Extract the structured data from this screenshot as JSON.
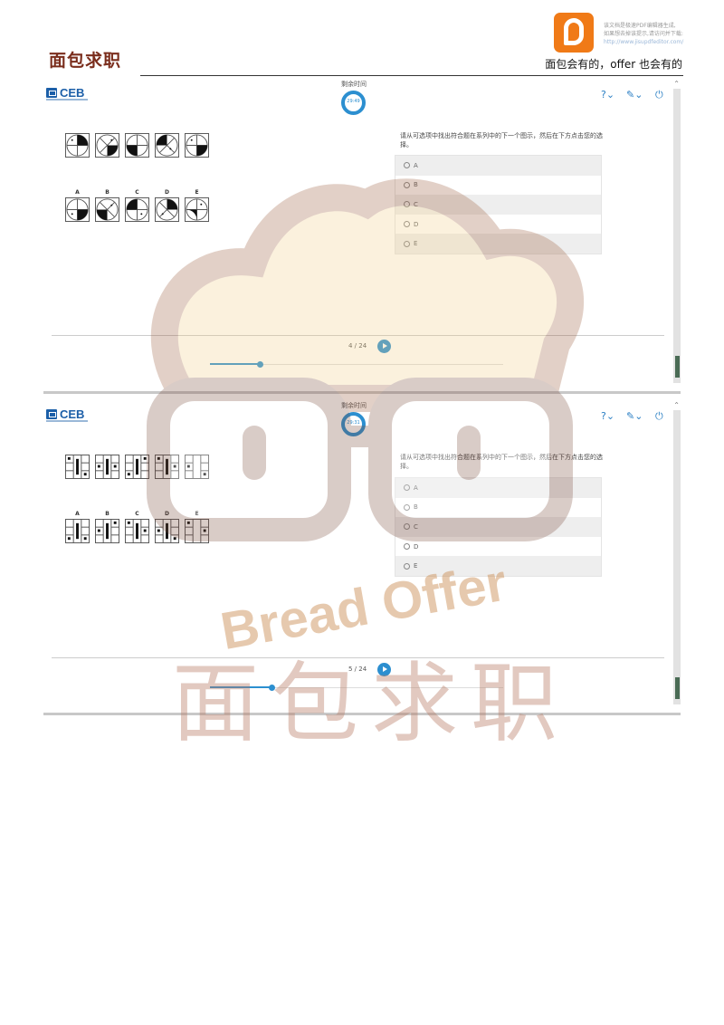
{
  "header": {
    "brand": "面包求职",
    "slogan": "面包会有的，offer 也会有的",
    "pdf_notice": [
      "该文档是极速PDF编辑器生成,",
      "如果想去掉该提示,请访问并下载:"
    ],
    "pdf_url": "http://www.jisupdfeditor.com/",
    "pdf_icon": "pdf-editor-app-icon"
  },
  "screens": [
    {
      "logo": "CEB",
      "timer_label": "剩余时间",
      "timer_value": "29:49",
      "question": "请从可选项中找出符合题在系列中的下一个图示，然后在下方点击您的选择。",
      "answer_letters": [
        "A",
        "B",
        "C",
        "D",
        "E"
      ],
      "options": [
        "A",
        "B",
        "C",
        "D",
        "E"
      ],
      "progress": "4 / 24",
      "progress_fraction": 0.17,
      "figure_style": "pie"
    },
    {
      "logo": "CEB",
      "timer_label": "剩余时间",
      "timer_value": "29:31",
      "question": "请从可选项中找出符合题在系列中的下一个图示，然后在下方点击您的选择。",
      "answer_letters": [
        "A",
        "B",
        "C",
        "D",
        "E"
      ],
      "options": [
        "A",
        "B",
        "C",
        "D",
        "E"
      ],
      "progress": "5 / 24",
      "progress_fraction": 0.21,
      "figure_style": "grid"
    }
  ],
  "toolbar_icons": [
    "help-icon",
    "accessibility-icon",
    "exit-icon"
  ],
  "watermark": {
    "text_en": "Bread Offer",
    "text_cn": "面包求职",
    "color": "#c98a4d"
  }
}
